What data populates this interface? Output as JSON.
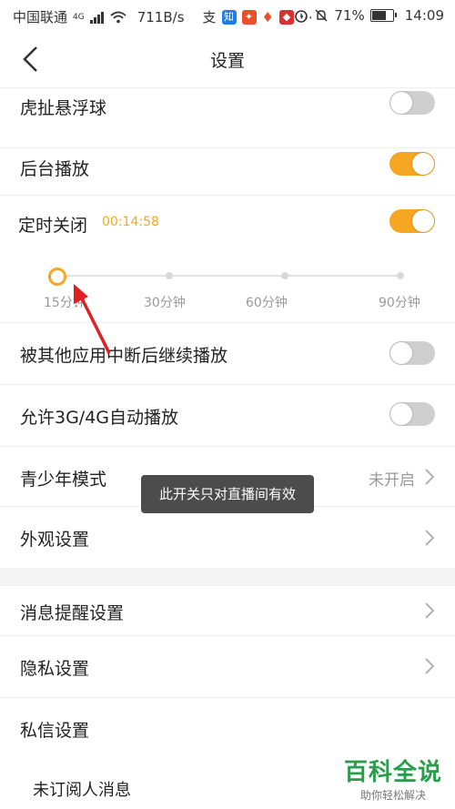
{
  "status_bar": {
    "carrier": "中国联通",
    "network": "4G",
    "speed": "711B/s",
    "battery": "71%",
    "battery_level": 0.71,
    "time": "14:09",
    "app_icons": [
      "alipay-icon",
      "zhihu-icon",
      "shop-icon",
      "map-pin-icon",
      "app-icon",
      "more-dots-icon"
    ]
  },
  "nav": {
    "title": "设置"
  },
  "settings": {
    "floating_ball": {
      "label": "虎扯悬浮球",
      "enabled": false
    },
    "background_play": {
      "label": "后台播放",
      "enabled": true
    },
    "sleep_timer": {
      "label": "定时关闭",
      "value": "00:14:58",
      "enabled": true
    },
    "timer_options": [
      "15分钟",
      "30分钟",
      "60分钟",
      "90分钟"
    ],
    "timer_selected": "15分钟",
    "resume_after_interrupt": {
      "label": "被其他应用中断后继续播放",
      "enabled": false
    },
    "mobile_autoplay": {
      "label": "允许3G/4G自动播放",
      "enabled": false
    },
    "teen_mode": {
      "label": "青少年模式",
      "value": "未开启"
    },
    "appearance": {
      "label": "外观设置"
    },
    "notifications": {
      "label": "消息提醒设置"
    },
    "privacy": {
      "label": "隐私设置"
    },
    "private_message": {
      "label": "私信设置"
    },
    "unsubscribed_messages": {
      "label": "未订阅人消息"
    }
  },
  "toast": "此开关只对直播间有效",
  "watermark": {
    "title": "百科全说",
    "subtitle": "助你轻松解决"
  },
  "colors": {
    "accent": "#f5a623",
    "toggle_off": "#cfcfcf",
    "annotation_arrow": "#e02020",
    "watermark": "#2a9d4b"
  }
}
